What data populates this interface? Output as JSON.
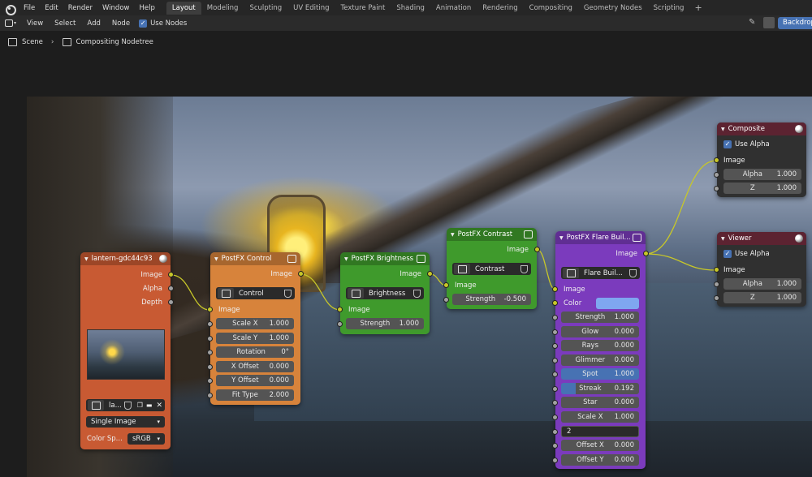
{
  "menubar": {
    "items": [
      "File",
      "Edit",
      "Render",
      "Window",
      "Help"
    ],
    "workspaces": [
      "Layout",
      "Modeling",
      "Sculpting",
      "UV Editing",
      "Texture Paint",
      "Shading",
      "Animation",
      "Rendering",
      "Compositing",
      "Geometry Nodes",
      "Scripting"
    ],
    "active_workspace": "Layout",
    "add_workspace": "+"
  },
  "header": {
    "items": [
      "View",
      "Select",
      "Add",
      "Node"
    ],
    "use_nodes_label": "Use Nodes",
    "use_nodes_checked": "✓",
    "backdrop_label": "Backdrop"
  },
  "breadcrumb": {
    "scene": "Scene",
    "tree": "Compositing Nodetree"
  },
  "nodes": {
    "image": {
      "title": "lantern-gdc44c93",
      "out_image": "Image",
      "out_alpha": "Alpha",
      "out_depth": "Depth",
      "image_name": "la...",
      "source": "Single Image",
      "colorspace_label": "Color Sp...",
      "colorspace": "sRGB",
      "color": "#c85a33"
    },
    "control": {
      "title": "PostFX Control",
      "out_image": "Image",
      "group": "Control",
      "in_image": "Image",
      "fields": [
        {
          "label": "Scale X",
          "value": "1.000"
        },
        {
          "label": "Scale Y",
          "value": "1.000"
        },
        {
          "label": "Rotation",
          "value": "0°"
        },
        {
          "label": "X Offset",
          "value": "0.000"
        },
        {
          "label": "Y Offset",
          "value": "0.000"
        },
        {
          "label": "Fit Type",
          "value": "2.000"
        }
      ],
      "color": "#d7833b"
    },
    "brightness": {
      "title": "PostFX Brightness",
      "out_image": "Image",
      "group": "Brightness",
      "in_image": "Image",
      "strength_label": "Strength",
      "strength": "1.000",
      "color": "#3f9a2c"
    },
    "contrast": {
      "title": "PostFX Contrast",
      "out_image": "Image",
      "group": "Contrast",
      "in_image": "Image",
      "strength_label": "Strength",
      "strength": "-0.500",
      "color": "#3f9a2c"
    },
    "flare": {
      "title": "PostFX Flare Buil...",
      "out_image": "Image",
      "group": "Flare Buil...",
      "in_image": "Image",
      "color_label": "Color",
      "swatch": "#7fa6f0",
      "fields": [
        {
          "label": "Strength",
          "value": "1.000"
        },
        {
          "label": "Glow",
          "value": "0.000"
        },
        {
          "label": "Rays",
          "value": "0.000"
        },
        {
          "label": "Glimmer",
          "value": "0.000"
        },
        {
          "label": "Spot",
          "value": "1.000"
        },
        {
          "label": "Streak",
          "value": "0.192"
        },
        {
          "label": "Star",
          "value": "0.000"
        },
        {
          "label": "Scale X",
          "value": "1.000"
        }
      ],
      "editing_value": "2",
      "fields_after": [
        {
          "label": "Offset X",
          "value": "0.000"
        },
        {
          "label": "Offset Y",
          "value": "0.000"
        }
      ],
      "color": "#7b3bbd"
    },
    "composite": {
      "title": "Composite",
      "use_alpha": "Use Alpha",
      "in_image": "Image",
      "alpha_label": "Alpha",
      "alpha": "1.000",
      "z_label": "Z",
      "z": "1.000"
    },
    "viewer": {
      "title": "Viewer",
      "use_alpha": "Use Alpha",
      "in_image": "Image",
      "alpha_label": "Alpha",
      "alpha": "1.000",
      "z_label": "Z",
      "z": "1.000"
    }
  }
}
